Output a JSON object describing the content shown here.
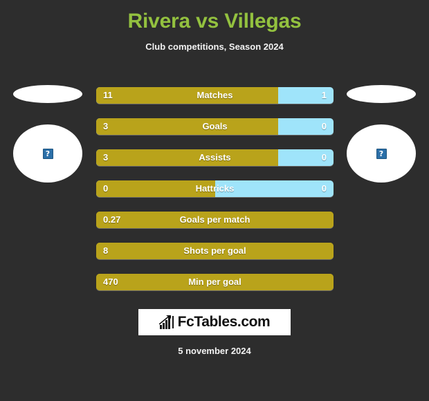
{
  "header": {
    "title": "Rivera vs Villegas",
    "subtitle": "Club competitions, Season 2024",
    "title_color": "#93c13f",
    "subtitle_color": "#f2f2f2"
  },
  "theme": {
    "background": "#2d2d2d",
    "home_color": "#b9a31b",
    "away_color": "#9fe4fa",
    "text_color": "#ffffff"
  },
  "players": {
    "home": {
      "club_logo_alt": "club-logo-placeholder",
      "photo_alt": "broken-image-placeholder",
      "photo_glyph": "?"
    },
    "away": {
      "club_logo_alt": "club-logo-placeholder",
      "photo_alt": "broken-image-placeholder",
      "photo_glyph": "?"
    }
  },
  "stats": [
    {
      "label": "Matches",
      "home": "11",
      "away": "1",
      "home_pct": 76.7,
      "has_away": true
    },
    {
      "label": "Goals",
      "home": "3",
      "away": "0",
      "home_pct": 76.7,
      "has_away": true
    },
    {
      "label": "Assists",
      "home": "3",
      "away": "0",
      "home_pct": 76.7,
      "has_away": true
    },
    {
      "label": "Hattricks",
      "home": "0",
      "away": "0",
      "home_pct": 50.0,
      "has_away": true
    },
    {
      "label": "Goals per match",
      "home": "0.27",
      "away": "",
      "home_pct": 100,
      "has_away": false
    },
    {
      "label": "Shots per goal",
      "home": "8",
      "away": "",
      "home_pct": 100,
      "has_away": false
    },
    {
      "label": "Min per goal",
      "home": "470",
      "away": "",
      "home_pct": 100,
      "has_away": false
    }
  ],
  "footer": {
    "brand_text": "FcTables.com",
    "brand_icon": "bar-chart-icon",
    "date": "5 november 2024"
  },
  "chart_data": {
    "type": "bar",
    "title": "Rivera vs Villegas",
    "subtitle": "Club competitions, Season 2024",
    "orientation": "horizontal-diverging",
    "categories": [
      "Matches",
      "Goals",
      "Assists",
      "Hattricks",
      "Goals per match",
      "Shots per goal",
      "Min per goal"
    ],
    "series": [
      {
        "name": "Rivera",
        "color": "#b9a31b",
        "values": [
          11,
          3,
          3,
          0,
          0.27,
          8,
          470
        ]
      },
      {
        "name": "Villegas",
        "color": "#9fe4fa",
        "values": [
          1,
          0,
          0,
          0,
          null,
          null,
          null
        ]
      }
    ],
    "legend": "none",
    "grid": false,
    "annotation": "5 november 2024"
  }
}
